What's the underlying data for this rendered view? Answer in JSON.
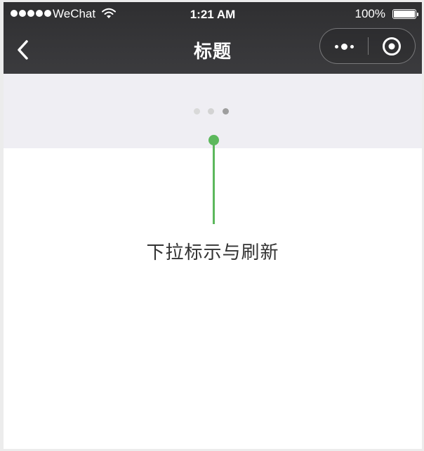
{
  "status_bar": {
    "carrier": "WeChat",
    "time": "1:21 AM",
    "battery": "100%",
    "signal_icon": "signal-dots-icon",
    "wifi_icon": "wifi-icon",
    "battery_icon": "battery-icon"
  },
  "navbar": {
    "title": "标题",
    "back_icon": "chevron-left-icon",
    "more_icon": "more-dots-icon",
    "close_icon": "target-close-icon",
    "background": "#333335"
  },
  "refresh": {
    "loading_dots": [
      {
        "color": "#d9d9d9"
      },
      {
        "color": "#d3d3d3"
      },
      {
        "color": "#9e9e9e"
      }
    ],
    "background": "#efeef3"
  },
  "annotation": {
    "text": "下拉标示与刷新",
    "accent_color": "#5cb85c"
  }
}
